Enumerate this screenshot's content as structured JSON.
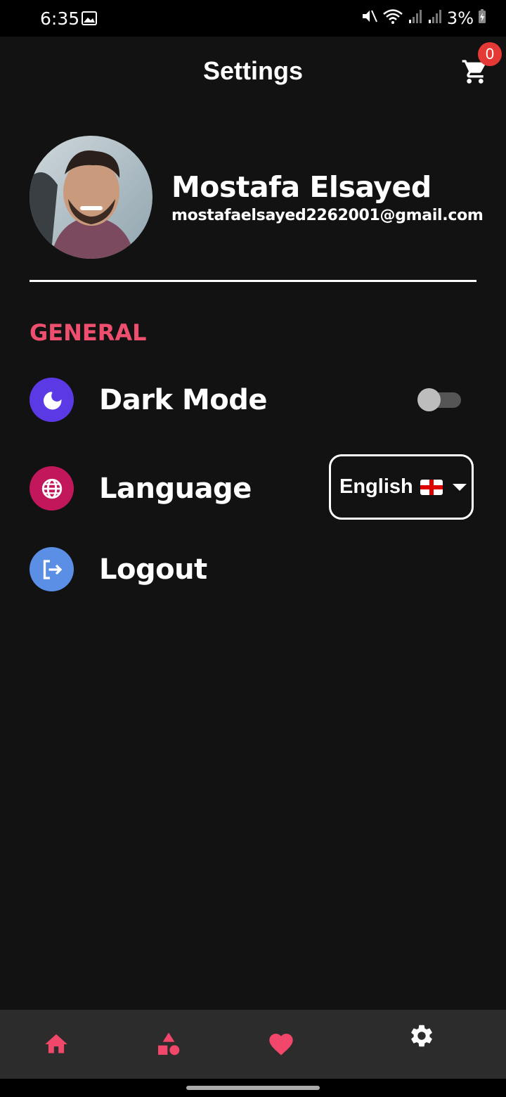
{
  "status": {
    "time": "6:35",
    "battery": "3%"
  },
  "header": {
    "title": "Settings",
    "cart_count": "0"
  },
  "profile": {
    "name": "Mostafa Elsayed",
    "email": "mostafaelsayed2262001@gmail.com"
  },
  "section": {
    "title": "GENERAL"
  },
  "settings": {
    "dark_mode": {
      "label": "Dark Mode",
      "enabled": false,
      "icon": "moon-icon",
      "color": "#5b3ae6"
    },
    "language": {
      "label": "Language",
      "selected": "English",
      "icon": "globe-icon",
      "color": "#c2185b"
    },
    "logout": {
      "label": "Logout",
      "icon": "logout-icon",
      "color": "#5b8fe6"
    }
  },
  "nav": {
    "items": [
      {
        "icon": "home-icon"
      },
      {
        "icon": "categories-icon"
      },
      {
        "icon": "heart-icon"
      },
      {
        "icon": "gear-icon"
      }
    ],
    "active_color": "#f0476a"
  }
}
